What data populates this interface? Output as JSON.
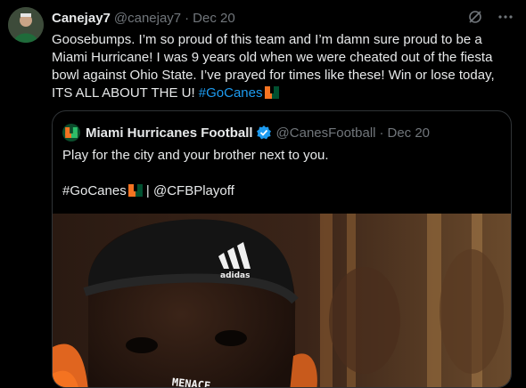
{
  "tweet": {
    "display_name": "Canejay7",
    "handle": "@canejay7",
    "separator": "·",
    "date": "Dec 20",
    "text_main": "Goosebumps. I’m so proud of this team and I’m damn sure proud to be a Miami Hurricane! I was 9 years old when we were cheated out of the fiesta bowl against Ohio State. I’ve prayed for times like these! Win or lose today, ITS ALL ABOUT THE U! ",
    "hashtag": "#GoCanes"
  },
  "quote": {
    "display_name": "Miami Hurricanes Football",
    "handle": "@CanesFootball",
    "separator": "·",
    "date": "Dec 20",
    "line1": "Play for the city and your brother next to you.",
    "hashtag": "#GoCanes",
    "pipe": "|",
    "mention": "@CFBPlayoff",
    "image_text": "MENACE",
    "image_brand": "adidas"
  },
  "colors": {
    "background": "#000000",
    "text": "#e7e9ea",
    "muted": "#71767b",
    "link": "#1d9bf0",
    "verified": "#1d9bf0",
    "border": "#2f3336",
    "miami_orange": "#f47321",
    "miami_green": "#005030"
  },
  "icons": {
    "grok": "grok-icon",
    "more": "more-icon",
    "verified": "verified-badge-icon",
    "logo": "miami-u-logo-icon"
  }
}
